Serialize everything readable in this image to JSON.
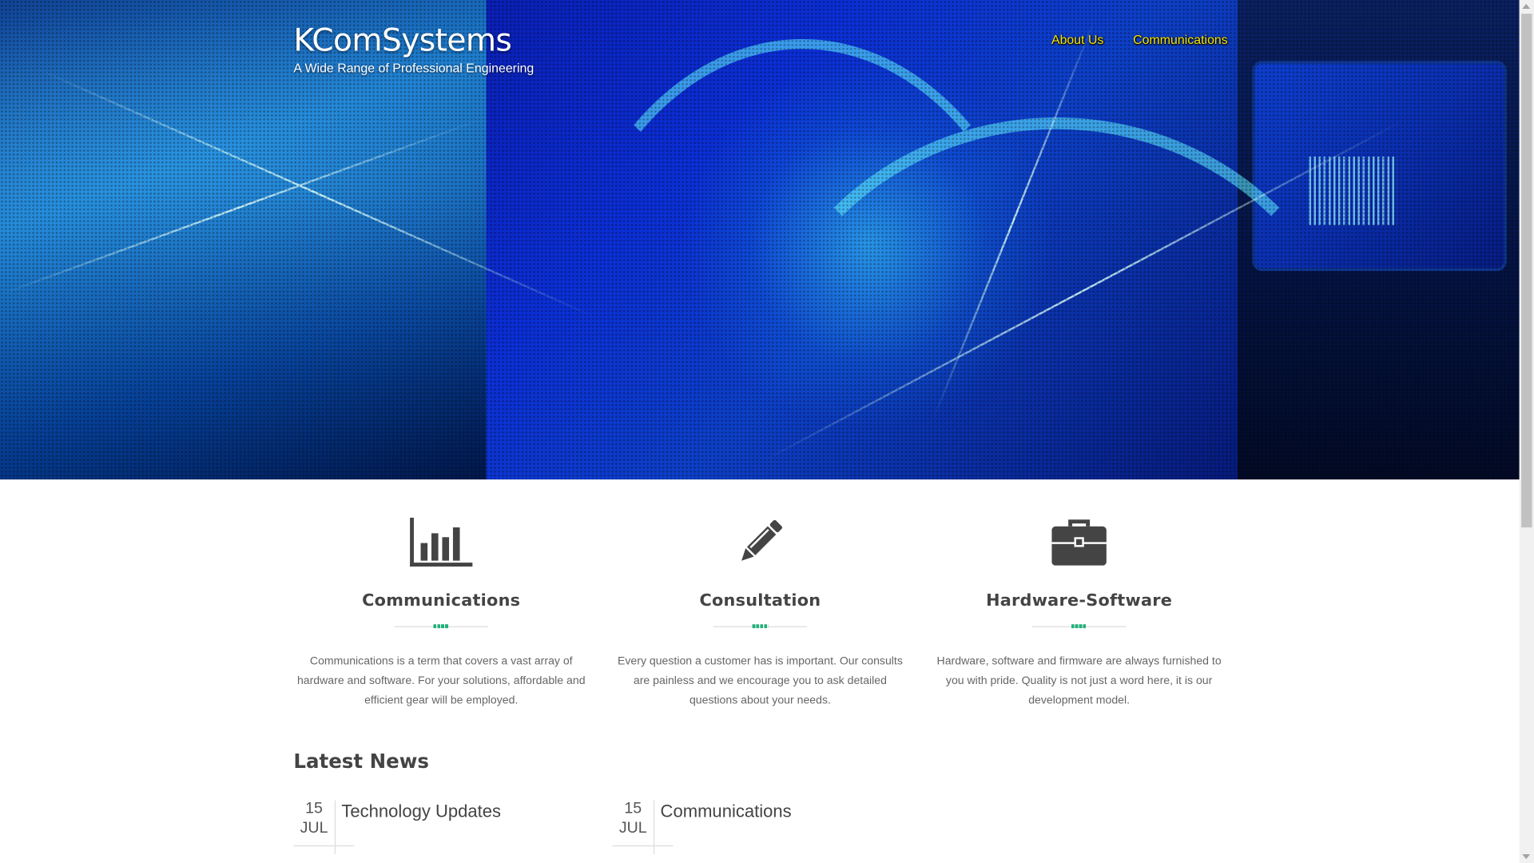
{
  "site": {
    "title": "KComSystems",
    "tagline": "A Wide Range of Professional Engineering"
  },
  "nav": {
    "items": [
      {
        "label": "About Us"
      },
      {
        "label": "Communications"
      }
    ],
    "color": "#f6e400"
  },
  "features": [
    {
      "icon": "bar-chart-icon",
      "title": "Communications",
      "text": "Communications is a term that covers a vast array of hardware and software. For your solutions, affordable and efficient gear will be employed."
    },
    {
      "icon": "pencil-icon",
      "title": "Consultation",
      "text": "Every question a customer has is important. Our consults are painless and we encourage you to ask detailed questions about your needs."
    },
    {
      "icon": "briefcase-icon",
      "title": "Hardware-Software",
      "text": "Hardware, software and firmware are always furnished to you with pride. Quality is not just a word here, it is our development model."
    }
  ],
  "news": {
    "heading": "Latest News",
    "items": [
      {
        "day": "15",
        "month": "JUL",
        "title": "Technology Updates"
      },
      {
        "day": "15",
        "month": "JUL",
        "title": "Communications"
      }
    ]
  },
  "colors": {
    "accent": "#22b07d",
    "icon": "#444444"
  }
}
